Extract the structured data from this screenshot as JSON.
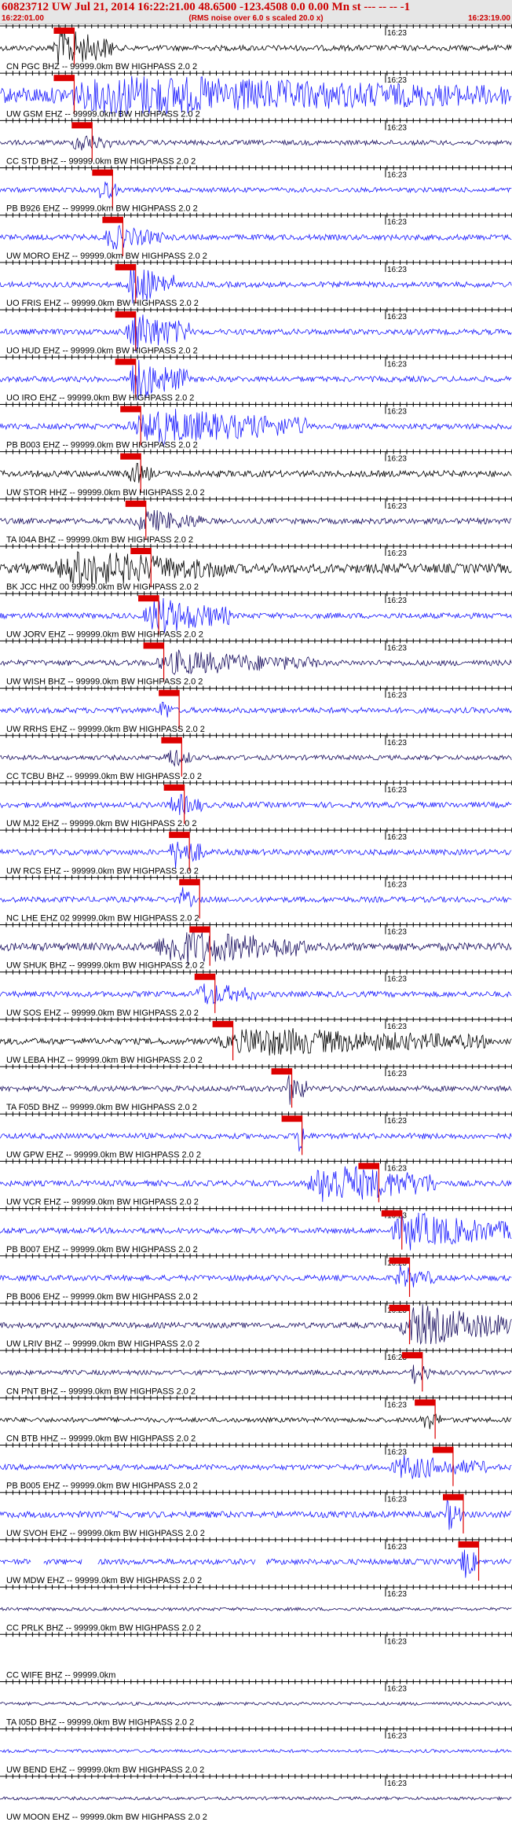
{
  "header": {
    "title": "60823712 UW Jul 21, 2014 16:22:21.00   48.6500 -123.4508  0.0 0.00 Mn st --- -- -- -1",
    "subtitle": "(RMS noise over 6.0 s scaled 20.0 x)",
    "start_time": "16:22:01.00",
    "end_time": "16:23:19.00"
  },
  "minute_mark": "16:23",
  "colors": {
    "header_text": "#cc0000",
    "pick_marker": "#dd0000",
    "trace_blue": "#1a1aff",
    "trace_navy": "#1a0f60",
    "trace_black": "#000000",
    "header_bg": "#e6e6e6"
  },
  "traces": [
    {
      "label": "CN PGC BHZ -- 99999.0km BW  HIGHPASS  2.0  2",
      "color": "black",
      "amp": 0.35,
      "pick": 0.105,
      "burst": [
        0.1,
        0.22,
        1.0
      ]
    },
    {
      "label": "UW GSM EHZ -- 99999.0km BW  HIGHPASS  2.0  2",
      "color": "blue",
      "amp": 1.0,
      "pick": 0.105,
      "burst": [
        0.1,
        1.0,
        1.0
      ]
    },
    {
      "label": "CC STD BHZ -- 99999.0km BW  HIGHPASS  2.0  2",
      "color": "navy",
      "amp": 0.3,
      "pick": 0.14,
      "burst": [
        0.14,
        0.22,
        0.5
      ]
    },
    {
      "label": "PB B926 EHZ -- 99999.0km BW  HIGHPASS  2.0  2",
      "color": "blue",
      "amp": 0.3,
      "pick": 0.18,
      "burst": [
        0.19,
        0.23,
        0.6
      ]
    },
    {
      "label": "UW MORO EHZ -- 99999.0km BW  HIGHPASS  2.0  2",
      "color": "blue",
      "amp": 0.35,
      "pick": 0.2,
      "burst": [
        0.2,
        0.32,
        0.6
      ]
    },
    {
      "label": "UO FRIS EHZ -- 99999.0km BW  HIGHPASS  2.0  2",
      "color": "blue",
      "amp": 0.35,
      "pick": 0.225,
      "burst": [
        0.245,
        0.34,
        1.0
      ]
    },
    {
      "label": "UO HUD EHZ -- 99999.0km BW  HIGHPASS  2.0  2",
      "color": "blue",
      "amp": 0.35,
      "pick": 0.225,
      "burst": [
        0.245,
        0.37,
        1.0
      ]
    },
    {
      "label": "UO IRO EHZ -- 99999.0km BW  HIGHPASS  2.0  2",
      "color": "blue",
      "amp": 0.35,
      "pick": 0.225,
      "burst": [
        0.245,
        0.37,
        1.0
      ]
    },
    {
      "label": "PB B003 EHZ -- 99999.0km BW  HIGHPASS  2.0  2",
      "color": "blue",
      "amp": 0.35,
      "pick": 0.235,
      "burst": [
        0.25,
        0.6,
        0.9
      ]
    },
    {
      "label": "UW STOR HHZ -- 99999.0km BW  HIGHPASS  2.0  2",
      "color": "black",
      "amp": 0.4,
      "pick": 0.235,
      "burst": [
        0.25,
        0.3,
        0.6
      ]
    },
    {
      "label": "TA I04A BHZ -- 99999.0km BW  HIGHPASS  2.0  2",
      "color": "navy",
      "amp": 0.35,
      "pick": 0.245,
      "burst": [
        0.26,
        0.4,
        0.6
      ]
    },
    {
      "label": "BK JCC HHZ 00 99999.0km BW  HIGHPASS  2.0  2",
      "color": "black",
      "amp": 0.6,
      "pick": 0.255,
      "burst": [
        0.1,
        0.45,
        0.9
      ]
    },
    {
      "label": "UW JORV EHZ -- 99999.0km BW  HIGHPASS  2.0  2",
      "color": "blue",
      "amp": 0.35,
      "pick": 0.27,
      "burst": [
        0.28,
        0.45,
        0.9
      ]
    },
    {
      "label": "UW WISH BHZ -- 99999.0km BW  HIGHPASS  2.0  2",
      "color": "navy",
      "amp": 0.35,
      "pick": 0.28,
      "burst": [
        0.3,
        0.62,
        0.6
      ]
    },
    {
      "label": "UW RRHS EHZ -- 99999.0km BW  HIGHPASS  2.0  2",
      "color": "blue",
      "amp": 0.35,
      "pick": 0.31,
      "burst": [
        0.31,
        0.34,
        0.6
      ]
    },
    {
      "label": "CC TCBU BHZ -- 99999.0km BW  HIGHPASS  2.0  2",
      "color": "navy",
      "amp": 0.3,
      "pick": 0.315,
      "burst": [
        0.32,
        0.38,
        0.5
      ]
    },
    {
      "label": "UW MJ2 EHZ -- 99999.0km BW  HIGHPASS  2.0  2",
      "color": "blue",
      "amp": 0.35,
      "pick": 0.32,
      "burst": [
        0.33,
        0.4,
        0.6
      ]
    },
    {
      "label": "UW RCS EHZ -- 99999.0km BW  HIGHPASS  2.0  2",
      "color": "blue",
      "amp": 0.35,
      "pick": 0.33,
      "burst": [
        0.33,
        0.4,
        0.8
      ]
    },
    {
      "label": "NC LHE EHZ 02 99999.0km BW  HIGHPASS  2.0  2",
      "color": "blue",
      "amp": 0.35,
      "pick": 0.35,
      "burst": [
        0.35,
        0.38,
        0.6
      ]
    },
    {
      "label": "UW SHUK BHZ -- 99999.0km BW  HIGHPASS  2.0  2",
      "color": "navy",
      "amp": 0.5,
      "pick": 0.37,
      "burst": [
        0.3,
        0.6,
        0.9
      ]
    },
    {
      "label": "UW SOS EHZ -- 99999.0km BW  HIGHPASS  2.0  2",
      "color": "blue",
      "amp": 0.35,
      "pick": 0.38,
      "burst": [
        0.38,
        0.5,
        0.6
      ]
    },
    {
      "label": "UW LEBA HHZ -- 99999.0km BW  HIGHPASS  2.0  2",
      "color": "black",
      "amp": 0.4,
      "pick": 0.415,
      "burst": [
        0.42,
        0.95,
        0.7
      ]
    },
    {
      "label": "TA F05D BHZ -- 99999.0km BW  HIGHPASS  2.0  2",
      "color": "navy",
      "amp": 0.35,
      "pick": 0.53,
      "burst": [
        0.56,
        0.6,
        0.8
      ]
    },
    {
      "label": "UW GPW EHZ -- 99999.0km BW  HIGHPASS  2.0  2",
      "color": "blue",
      "amp": 0.35,
      "pick": 0.55,
      "burst": [
        0.58,
        0.6,
        1.0
      ]
    },
    {
      "label": "UW VCR EHZ -- 99999.0km BW  HIGHPASS  2.0  2",
      "color": "blue",
      "amp": 0.35,
      "pick": 0.7,
      "burst": [
        0.6,
        0.85,
        1.0
      ]
    },
    {
      "label": "PB B007 EHZ -- 99999.0km BW  HIGHPASS  2.0  2",
      "color": "blue",
      "amp": 0.35,
      "pick": 0.745,
      "burst": [
        0.76,
        1.0,
        0.9
      ]
    },
    {
      "label": "PB B006 EHZ -- 99999.0km BW  HIGHPASS  2.0  2",
      "color": "blue",
      "amp": 0.35,
      "pick": 0.76,
      "burst": [
        0.77,
        0.85,
        0.6
      ]
    },
    {
      "label": "UW LRIV BHZ -- 99999.0km BW  HIGHPASS  2.0  2",
      "color": "navy",
      "amp": 0.35,
      "pick": 0.76,
      "burst": [
        0.78,
        1.0,
        1.0
      ]
    },
    {
      "label": "CN PNT BHZ -- 99999.0km BW  HIGHPASS  2.0  2",
      "color": "navy",
      "amp": 0.3,
      "pick": 0.785,
      "burst": [
        0.8,
        0.84,
        0.6
      ]
    },
    {
      "label": "CN BTB HHZ -- 99999.0km BW  HIGHPASS  2.0  2",
      "color": "black",
      "amp": 0.3,
      "pick": 0.81,
      "burst": [
        0.82,
        0.86,
        0.6
      ]
    },
    {
      "label": "PB B005 EHZ -- 99999.0km BW  HIGHPASS  2.0  2",
      "color": "blue",
      "amp": 0.35,
      "pick": 0.845,
      "burst": [
        0.76,
        0.95,
        0.6
      ]
    },
    {
      "label": "UW SVOH EHZ -- 99999.0km BW  HIGHPASS  2.0  2",
      "color": "blue",
      "amp": 0.4,
      "pick": 0.865,
      "burst": [
        0.87,
        0.9,
        0.8
      ]
    },
    {
      "label": "UW MDW EHZ -- 99999.0km BW  HIGHPASS  2.0  2",
      "color": "blue",
      "amp": 0.35,
      "pick": 0.895,
      "burst": [
        0.9,
        0.93,
        0.9
      ],
      "gaps": true
    },
    {
      "label": "CC PRLK BHZ -- 99999.0km BW  HIGHPASS  2.0  2",
      "color": "navy",
      "amp": 0.2
    },
    {
      "label": "CC WIFE BHZ -- 99999.0km",
      "color": "none",
      "amp": 0
    },
    {
      "label": "TA I05D BHZ -- 99999.0km BW  HIGHPASS  2.0  2",
      "color": "navy",
      "amp": 0.2
    },
    {
      "label": "UW BEND EHZ -- 99999.0km BW  HIGHPASS  2.0  2",
      "color": "blue",
      "amp": 0.2
    },
    {
      "label": "UW MOON EHZ -- 99999.0km BW  HIGHPASS  2.0  2",
      "color": "navy",
      "amp": 0.2
    }
  ]
}
